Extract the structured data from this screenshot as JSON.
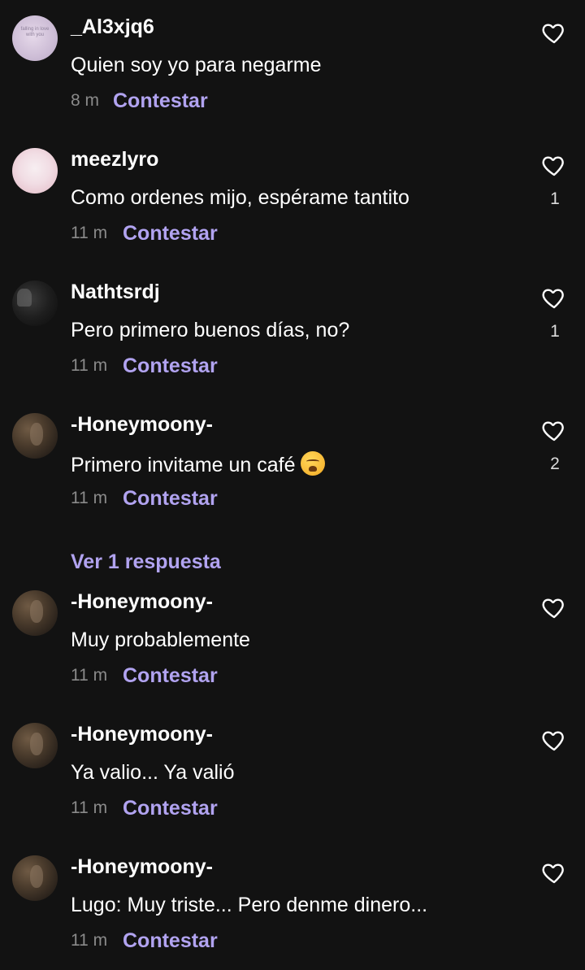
{
  "comments": [
    {
      "username": "_Al3xjq6",
      "text": "Quien soy yo para negarme",
      "time": "8 m",
      "reply_label": "Contestar",
      "likes": "",
      "avatar_text": "falling in love with you"
    },
    {
      "username": "meezlyro",
      "text": "Como ordenes mijo, espérame tantito",
      "time": "11 m",
      "reply_label": "Contestar",
      "likes": "1"
    },
    {
      "username": "Nathtsrdj",
      "text": "Pero primero buenos días, no?",
      "time": "11 m",
      "reply_label": "Contestar",
      "likes": "1"
    },
    {
      "username": "-Honeymoony-",
      "text": "Primero invitame un café",
      "time": "11 m",
      "reply_label": "Contestar",
      "likes": "2",
      "emoji": "weary-face-emoji"
    },
    {
      "username": "-Honeymoony-",
      "text": "Muy probablemente",
      "time": "11 m",
      "reply_label": "Contestar",
      "likes": ""
    },
    {
      "username": "-Honeymoony-",
      "text": "Ya valio... Ya valió",
      "time": "11 m",
      "reply_label": "Contestar",
      "likes": ""
    },
    {
      "username": "-Honeymoony-",
      "text": "Lugo: Muy triste... Pero denme dinero...",
      "time": "11 m",
      "reply_label": "Contestar",
      "likes": ""
    }
  ],
  "view_replies_label": "Ver 1 respuesta",
  "icons": {
    "like": "heart-outline-icon"
  },
  "colors": {
    "background": "#121212",
    "accent": "#b1a3f0",
    "meta": "#8a8a8a",
    "text": "#ffffff"
  }
}
